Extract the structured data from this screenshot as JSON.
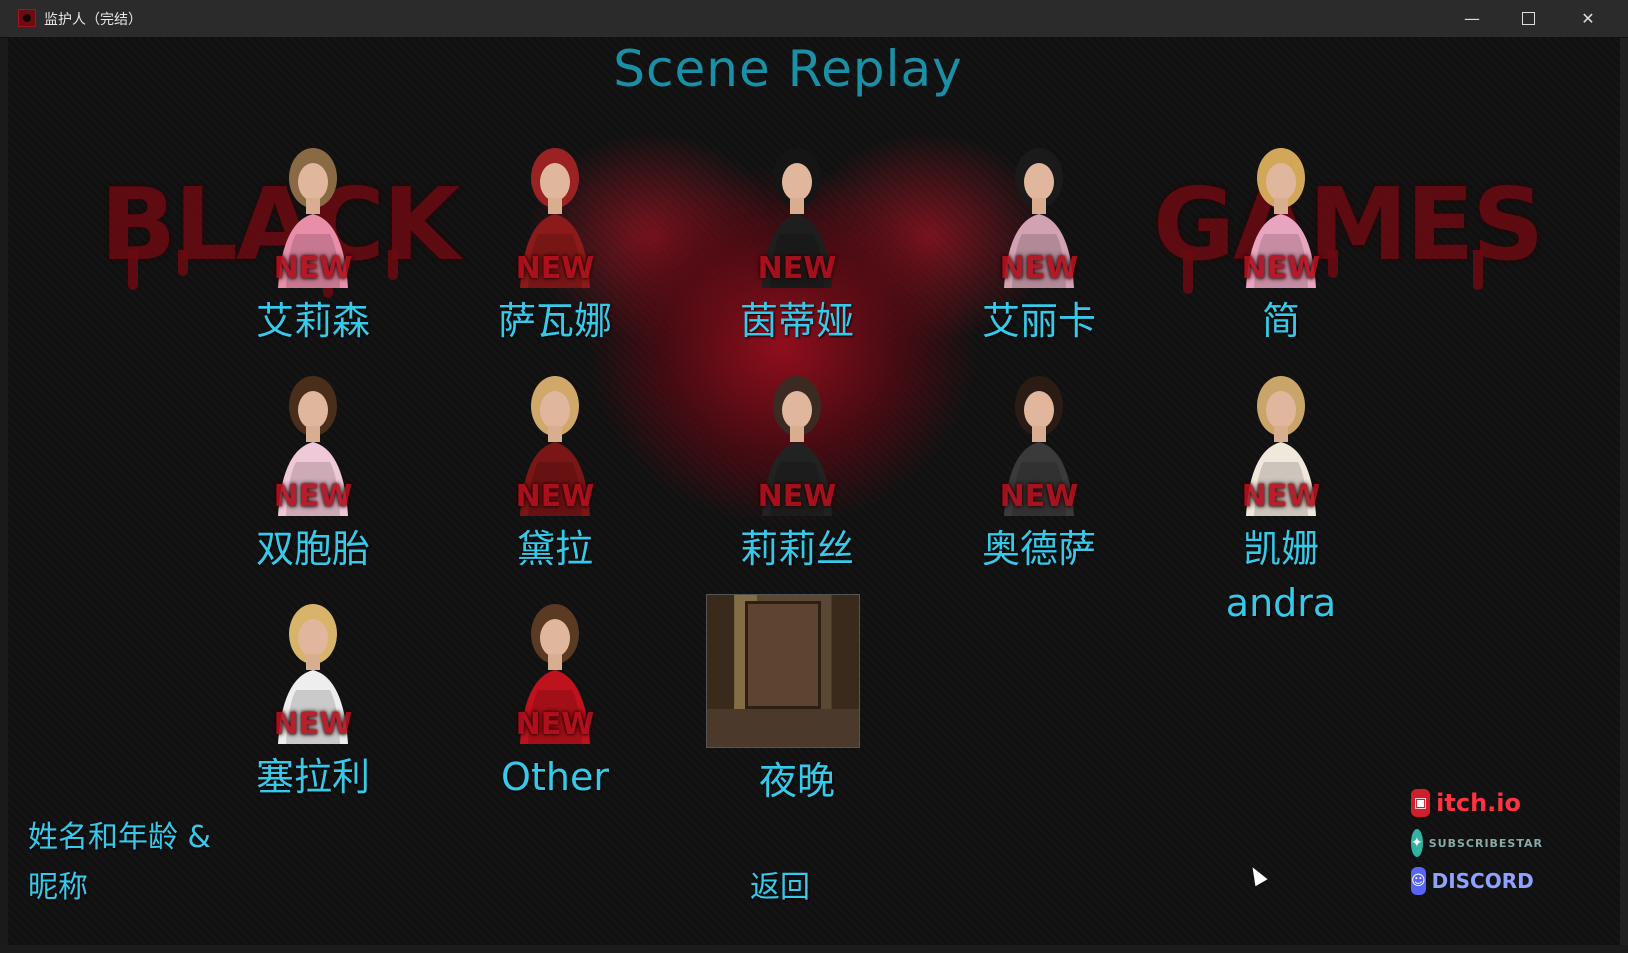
{
  "window": {
    "title": "监护人（完结）",
    "minimize": "—",
    "close": "✕",
    "icon": "app-icon"
  },
  "screen": {
    "title": "Scene Replay",
    "brand_left": "BLACK",
    "brand_right": "GAMES"
  },
  "characters": [
    {
      "name": "艾莉森",
      "badge": "NEW",
      "hair": "#8a6a45",
      "top": "#e88ea8"
    },
    {
      "name": "萨瓦娜",
      "badge": "NEW",
      "hair": "#9a2222",
      "top": "#8d1a1a"
    },
    {
      "name": "茵蒂娅",
      "badge": "NEW",
      "hair": "#151515",
      "top": "#1e1e1e"
    },
    {
      "name": "艾丽卡",
      "badge": "NEW",
      "hair": "#1a1a1a",
      "top": "#d2a2b2"
    },
    {
      "name": "简",
      "badge": "NEW",
      "hair": "#d3a75a",
      "top": "#e8a5c0"
    },
    {
      "name": "双胞胎",
      "badge": "NEW",
      "hair": "#4a2e1a",
      "top": "#f0c9d8"
    },
    {
      "name": "黛拉",
      "badge": "NEW",
      "hair": "#cfa86a",
      "top": "#7a1616"
    },
    {
      "name": "莉莉丝",
      "badge": "NEW",
      "hair": "#3a2a22",
      "top": "#222222"
    },
    {
      "name": "奥德萨",
      "badge": "NEW",
      "hair": "#2a1c14",
      "top": "#3a3a3a"
    },
    {
      "name": "凯姗\nandra",
      "badge": "NEW",
      "hair": "#c9a56a",
      "top": "#f1e8dc"
    },
    {
      "name": "塞拉利",
      "badge": "NEW",
      "hair": "#d8b46a",
      "top": "#eeeeee"
    },
    {
      "name": "Other",
      "badge": "NEW",
      "hair": "#5a3a22",
      "top": "#c0121c"
    },
    {
      "name": "夜晚",
      "badge": "",
      "hair": "",
      "top": ""
    }
  ],
  "footer": {
    "names_ages": "姓名和年龄 &",
    "nicknames": "昵称",
    "back": "返回"
  },
  "social": {
    "itch": {
      "label": "itch.io",
      "icon": "itch-icon"
    },
    "subscribestar": {
      "label": "SUBSCRIBESTAR",
      "icon": "subscribestar-icon"
    },
    "discord": {
      "label": "DISCORD",
      "icon": "discord-icon"
    }
  },
  "colors": {
    "label": "#37c9ea",
    "title": "#1a8fa6",
    "badge": "#b30f1d",
    "brand": "#6b0a12"
  }
}
